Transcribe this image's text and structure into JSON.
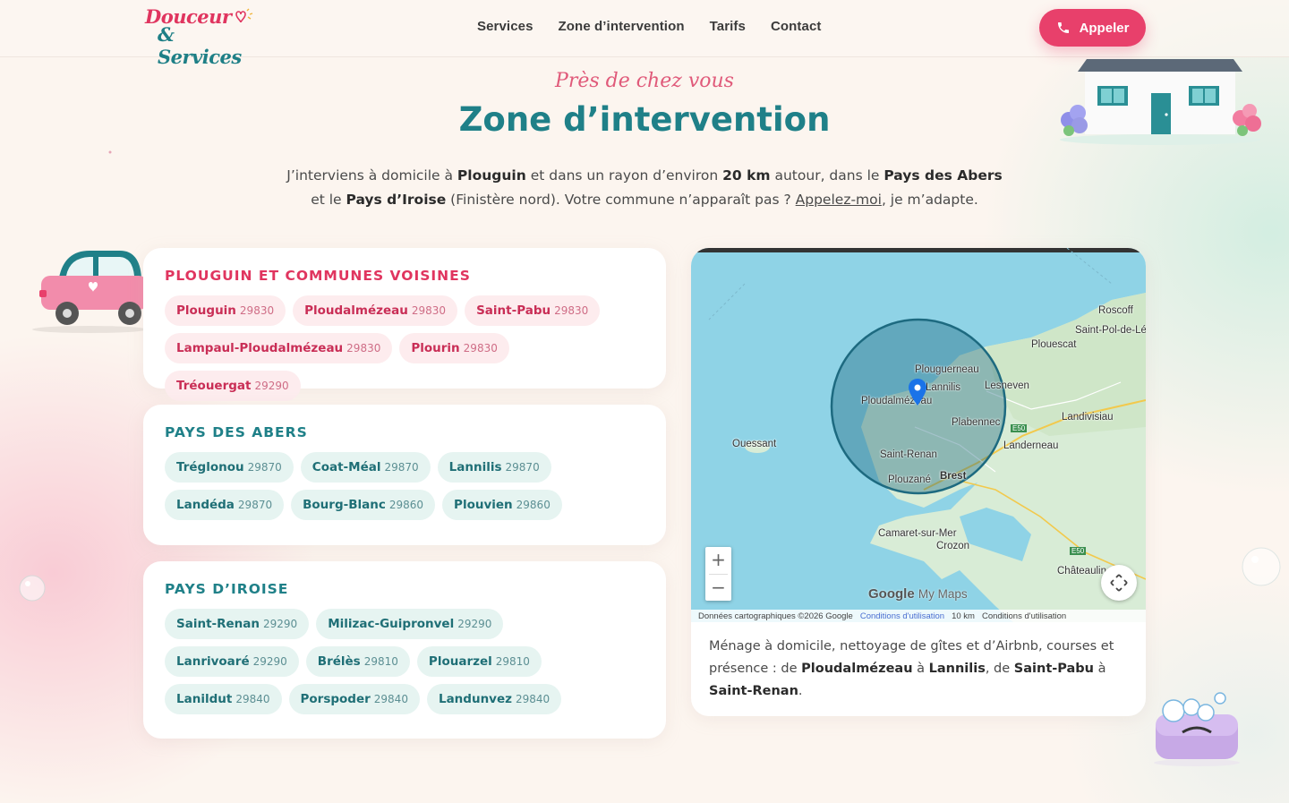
{
  "brand": {
    "line1": "Douceur",
    "line2": "& Services"
  },
  "nav": {
    "items": [
      "Services",
      "Zone d’intervention",
      "Tarifs",
      "Contact"
    ],
    "call_label": "Appeler"
  },
  "hero": {
    "kicker": "Près de chez vous",
    "title": "Zone d’intervention",
    "intro": {
      "p1": "J’interviens à domicile à ",
      "b1": "Plouguin",
      "p2": " et dans un rayon d’environ ",
      "b2": "20 km",
      "p3": " autour, dans le ",
      "b3": "Pays des Abers",
      "p4": " et le ",
      "b4": "Pays d’Iroise",
      "p5": " (Finistère nord). Votre commune n’apparaît pas ? ",
      "link": "Appelez-moi",
      "p6": ", je m’adapte."
    }
  },
  "zones": [
    {
      "title": "PLOUGUIN ET COMMUNES VOISINES",
      "theme": "pink",
      "towns": [
        {
          "name": "Plouguin",
          "cp": "29830"
        },
        {
          "name": "Ploudalmézeau",
          "cp": "29830"
        },
        {
          "name": "Saint-Pabu",
          "cp": "29830"
        },
        {
          "name": "Lampaul-Ploudalmézeau",
          "cp": "29830"
        },
        {
          "name": "Plourin",
          "cp": "29830"
        },
        {
          "name": "Tréouergat",
          "cp": "29290"
        }
      ]
    },
    {
      "title": "PAYS DES ABERS",
      "theme": "teal",
      "towns": [
        {
          "name": "Tréglonou",
          "cp": "29870"
        },
        {
          "name": "Coat-Méal",
          "cp": "29870"
        },
        {
          "name": "Lannilis",
          "cp": "29870"
        },
        {
          "name": "Landéda",
          "cp": "29870"
        },
        {
          "name": "Bourg-Blanc",
          "cp": "29860"
        },
        {
          "name": "Plouvien",
          "cp": "29860"
        }
      ]
    },
    {
      "title": "PAYS D’IROISE",
      "theme": "teal",
      "towns": [
        {
          "name": "Saint-Renan",
          "cp": "29290"
        },
        {
          "name": "Milizac-Guipronvel",
          "cp": "29290"
        },
        {
          "name": "Lanrivoaré",
          "cp": "29290"
        },
        {
          "name": "Brélès",
          "cp": "29810"
        },
        {
          "name": "Plouarzel",
          "cp": "29810"
        },
        {
          "name": "Lanildut",
          "cp": "29840"
        },
        {
          "name": "Porspoder",
          "cp": "29840"
        },
        {
          "name": "Landunvez",
          "cp": "29840"
        }
      ]
    }
  ],
  "map": {
    "labels": {
      "roscoff": "Roscoff",
      "saint_pol": "Saint-Pol-de-Lé",
      "plouescat": "Plouescat",
      "plouguerneau": "Plouguerneau",
      "lannilis": "Lannilis",
      "lesneven": "Lesneven",
      "ploudalmezeau": "Ploudalmézeau",
      "landivisiau": "Landivisiau",
      "plabennec": "Plabennec",
      "ouessant": "Ouessant",
      "landerneau": "Landerneau",
      "saint_renan": "Saint-Renan",
      "plouzane": "Plouzané",
      "brest": "Brest",
      "camaret": "Camaret-sur-Mer",
      "crozon": "Crozon",
      "chateaulin": "Châteaulin",
      "road_e50": "E50"
    },
    "zoom_in": "+",
    "zoom_out": "−",
    "google": "Google",
    "my_maps": "My Maps",
    "attribution": "Données cartographiques ©2026 Google",
    "terms": "Conditions d'utilisation",
    "scale": "10 km",
    "terms2": "Conditions d'utilisation",
    "colors": {
      "sea": "#8fd3e6",
      "land": "#d8ecd6",
      "circle": "#1d6a80",
      "pin": "#1a73e8"
    }
  },
  "map_caption": {
    "p1": "Ménage à domicile, nettoyage de gîtes et d’Airbnb, courses et présence : de ",
    "b1": "Ploudalmézeau",
    "p2": " à ",
    "b2": "Lannilis",
    "p3": ", de ",
    "b3": "Saint-Pabu",
    "p4": " à ",
    "b4": "Saint-Renan",
    "p5": "."
  },
  "icons": [
    "phone-icon",
    "map-pin-icon",
    "fullscreen-icon",
    "heart-icon"
  ]
}
